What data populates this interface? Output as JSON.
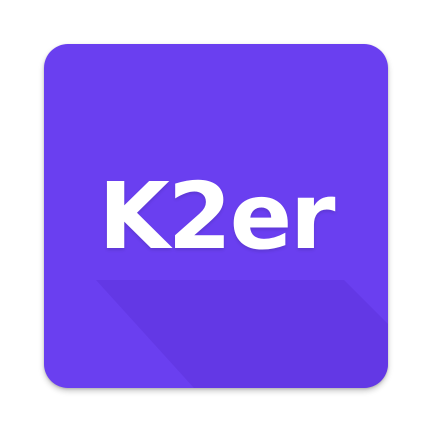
{
  "icon": {
    "logotype": "K2er",
    "background_color": "#6a3ff0",
    "shadow_color": "#5a30d8",
    "text_color": "#ffffff"
  }
}
